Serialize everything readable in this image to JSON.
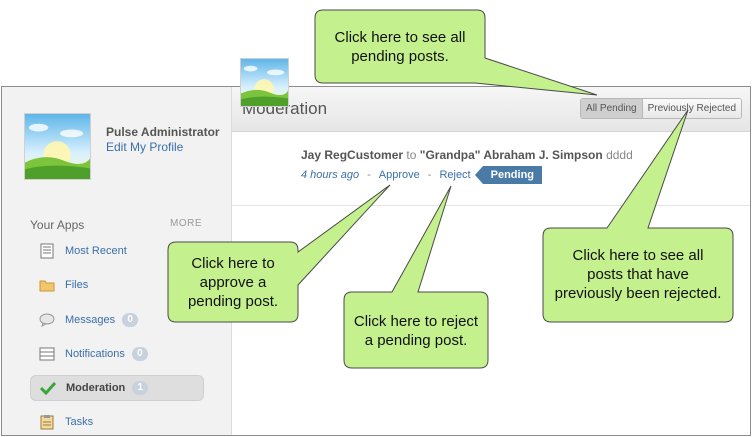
{
  "profile": {
    "name": "Pulse Administrator",
    "edit_link": "Edit My Profile"
  },
  "apps": {
    "title": "Your Apps",
    "more": "MORE",
    "items": [
      {
        "label": "Most Recent",
        "icon": "document-icon"
      },
      {
        "label": "Files",
        "icon": "folder-icon"
      },
      {
        "label": "Messages",
        "icon": "speech-bubble-icon",
        "count": "0"
      },
      {
        "label": "Notifications",
        "icon": "notifications-list-icon",
        "count": "0"
      },
      {
        "label": "Moderation",
        "icon": "checkmark-icon",
        "count": "1",
        "active": true
      },
      {
        "label": "Tasks",
        "icon": "clipboard-icon"
      }
    ]
  },
  "main": {
    "title": "Moderation",
    "filters": {
      "all_pending": "All Pending",
      "previously_rejected": "Previously Rejected"
    }
  },
  "post": {
    "author": "Jay RegCustomer",
    "to_word": "to",
    "recipient": "\"Grandpa\" Abraham J. Simpson",
    "text": "dddd",
    "time": "4 hours ago",
    "approve": "Approve",
    "reject": "Reject",
    "status": "Pending",
    "separator": "-"
  },
  "callouts": {
    "all_pending": [
      "Click here to see all",
      "pending posts."
    ],
    "approve": [
      "Click here to",
      "approve a",
      "pending post."
    ],
    "reject": [
      "Click here to reject",
      "a pending post."
    ],
    "rejected": [
      "Click here to see all",
      "posts that have",
      "previously been rejected."
    ]
  },
  "colors": {
    "callout_fill": "#c5f08e",
    "callout_stroke": "#4a4a4a",
    "link": "#3a6fa8",
    "badge": "#4a7ba6"
  }
}
